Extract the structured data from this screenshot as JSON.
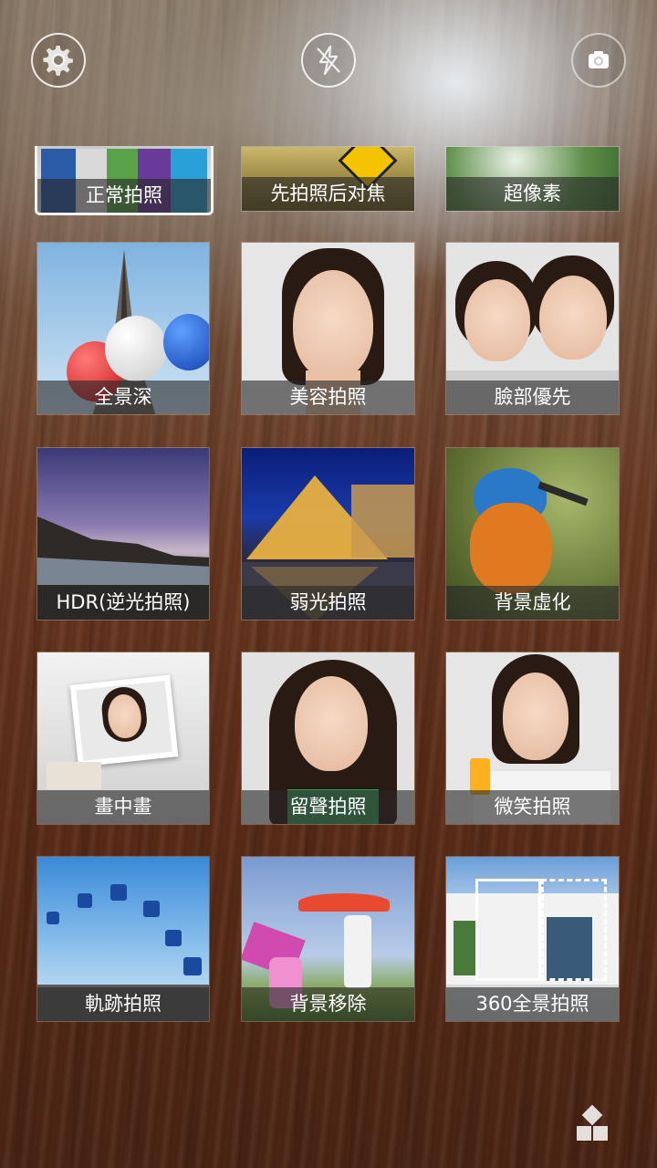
{
  "top_bar": {
    "settings_icon": "gear-icon",
    "flash_icon": "flash-off-icon",
    "switch_camera_icon": "camera-switch-icon"
  },
  "modes": [
    {
      "id": "normal",
      "label": "正常拍照"
    },
    {
      "id": "refocus",
      "label": "先拍照后对焦"
    },
    {
      "id": "super-resolution",
      "label": "超像素"
    },
    {
      "id": "depth-of-field",
      "label": "全景深"
    },
    {
      "id": "beautification",
      "label": "美容拍照"
    },
    {
      "id": "face-priority",
      "label": "臉部優先"
    },
    {
      "id": "hdr",
      "label": "HDR(逆光拍照)"
    },
    {
      "id": "low-light",
      "label": "弱光拍照"
    },
    {
      "id": "background-blur",
      "label": "背景虛化"
    },
    {
      "id": "picture-in-picture",
      "label": "畫中畫"
    },
    {
      "id": "voice-photo",
      "label": "留聲拍照"
    },
    {
      "id": "smile-shot",
      "label": "微笑拍照"
    },
    {
      "id": "trajectory",
      "label": "軌跡拍照"
    },
    {
      "id": "remove-background",
      "label": "背景移除"
    },
    {
      "id": "panorama-360",
      "label": "360全景拍照"
    }
  ],
  "selected_mode": "normal",
  "bottom": {
    "grid_icon": "grid-view-icon"
  },
  "colors": {
    "label_bg": "#282828",
    "selected_border": "#f2f2f2"
  }
}
